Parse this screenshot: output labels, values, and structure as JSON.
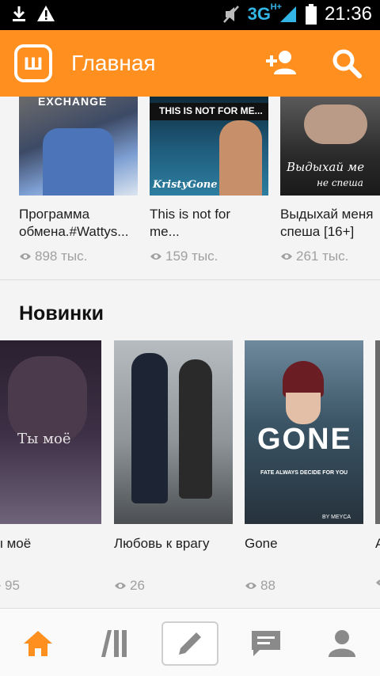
{
  "status_bar": {
    "network": "3G",
    "network_sup": "H+",
    "time": "21:36"
  },
  "app_bar": {
    "logo_letter": "ш",
    "title": "Главная",
    "add_user_icon": "add-user-icon",
    "search_icon": "search-icon"
  },
  "top_row": [
    {
      "title": "Программа обмена.#Wattys...",
      "reads": "898 тыс.",
      "cover_text": "EXCHANGE"
    },
    {
      "title": "This is not for me...",
      "reads": "159 тыс.",
      "cover_text": "THIS IS NOT FOR ME...",
      "cover_sub": "KristyGone"
    },
    {
      "title": "Выдыхай меня спеша [16+]",
      "reads": "261 тыс.",
      "cover_text": "Выдыхай ме",
      "cover_sub": "не спеша"
    }
  ],
  "new_section": {
    "title": "Новинки",
    "books": [
      {
        "title": "Ты моё",
        "reads": "95",
        "cover_text": "Ты моё"
      },
      {
        "title": "Любовь к врагу",
        "reads": "26"
      },
      {
        "title": "Gone",
        "reads": "88",
        "cover_text": "GONE",
        "cover_sub": "FATE ALWAYS DECIDE FOR YOU",
        "cover_credit": "BY MEYCA"
      },
      {
        "title": "A",
        "reads": ""
      }
    ]
  },
  "bottom_nav": {
    "items": [
      "home-icon",
      "library-icon",
      "write-icon",
      "messages-icon",
      "profile-icon"
    ],
    "accent": "#ff8f1f",
    "inactive": "#8a8a8a"
  },
  "colors": {
    "accent": "#ff8f1f",
    "background": "#f4f4f4"
  }
}
